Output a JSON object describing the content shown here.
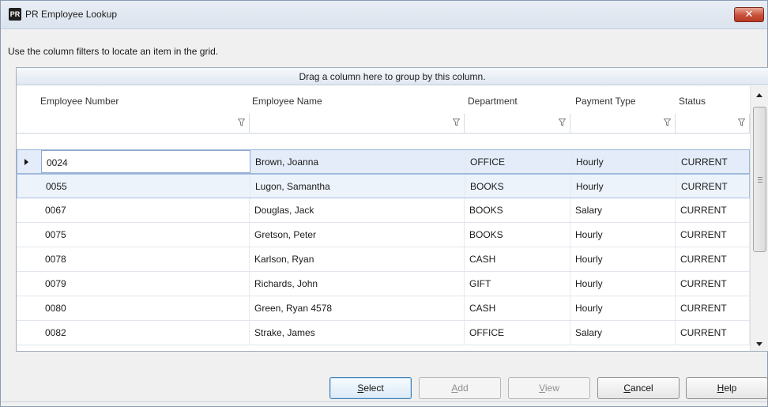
{
  "window": {
    "title": "PR Employee Lookup",
    "icon_label": "PR",
    "close_icon": "close-icon"
  },
  "hint": "Use the column filters to locate an item in the grid.",
  "grid": {
    "group_panel_text": "Drag a column here to group by this column.",
    "columns": [
      "Employee Number",
      "Employee Name",
      "Department",
      "Payment Type",
      "Status"
    ],
    "rows": [
      {
        "number": "0024",
        "name": "Brown, Joanna",
        "department": "OFFICE",
        "payment": "Hourly",
        "status": "CURRENT"
      },
      {
        "number": "0055",
        "name": "Lugon, Samantha",
        "department": "BOOKS",
        "payment": "Hourly",
        "status": "CURRENT"
      },
      {
        "number": "0067",
        "name": "Douglas, Jack",
        "department": "BOOKS",
        "payment": "Salary",
        "status": "CURRENT"
      },
      {
        "number": "0075",
        "name": "Gretson, Peter",
        "department": "BOOKS",
        "payment": "Hourly",
        "status": "CURRENT"
      },
      {
        "number": "0078",
        "name": "Karlson, Ryan",
        "department": "CASH",
        "payment": "Hourly",
        "status": "CURRENT"
      },
      {
        "number": "0079",
        "name": "Richards, John",
        "department": "GIFT",
        "payment": "Hourly",
        "status": "CURRENT"
      },
      {
        "number": "0080",
        "name": "Green, Ryan 4578",
        "department": "CASH",
        "payment": "Hourly",
        "status": "CURRENT"
      },
      {
        "number": "0082",
        "name": "Strake, James",
        "department": "OFFICE",
        "payment": "Salary",
        "status": "CURRENT"
      }
    ]
  },
  "buttons": {
    "select": {
      "mnemonic": "S",
      "rest": "elect"
    },
    "add": {
      "mnemonic": "A",
      "rest": "dd"
    },
    "view": {
      "mnemonic": "V",
      "rest": "iew"
    },
    "cancel": {
      "mnemonic": "C",
      "rest": "ancel"
    },
    "help": {
      "mnemonic": "H",
      "rest": "elp"
    }
  },
  "colors": {
    "selected_row": "#e3ecf8",
    "close_button": "#c75039",
    "primary_button_border": "#3c7fb1"
  }
}
